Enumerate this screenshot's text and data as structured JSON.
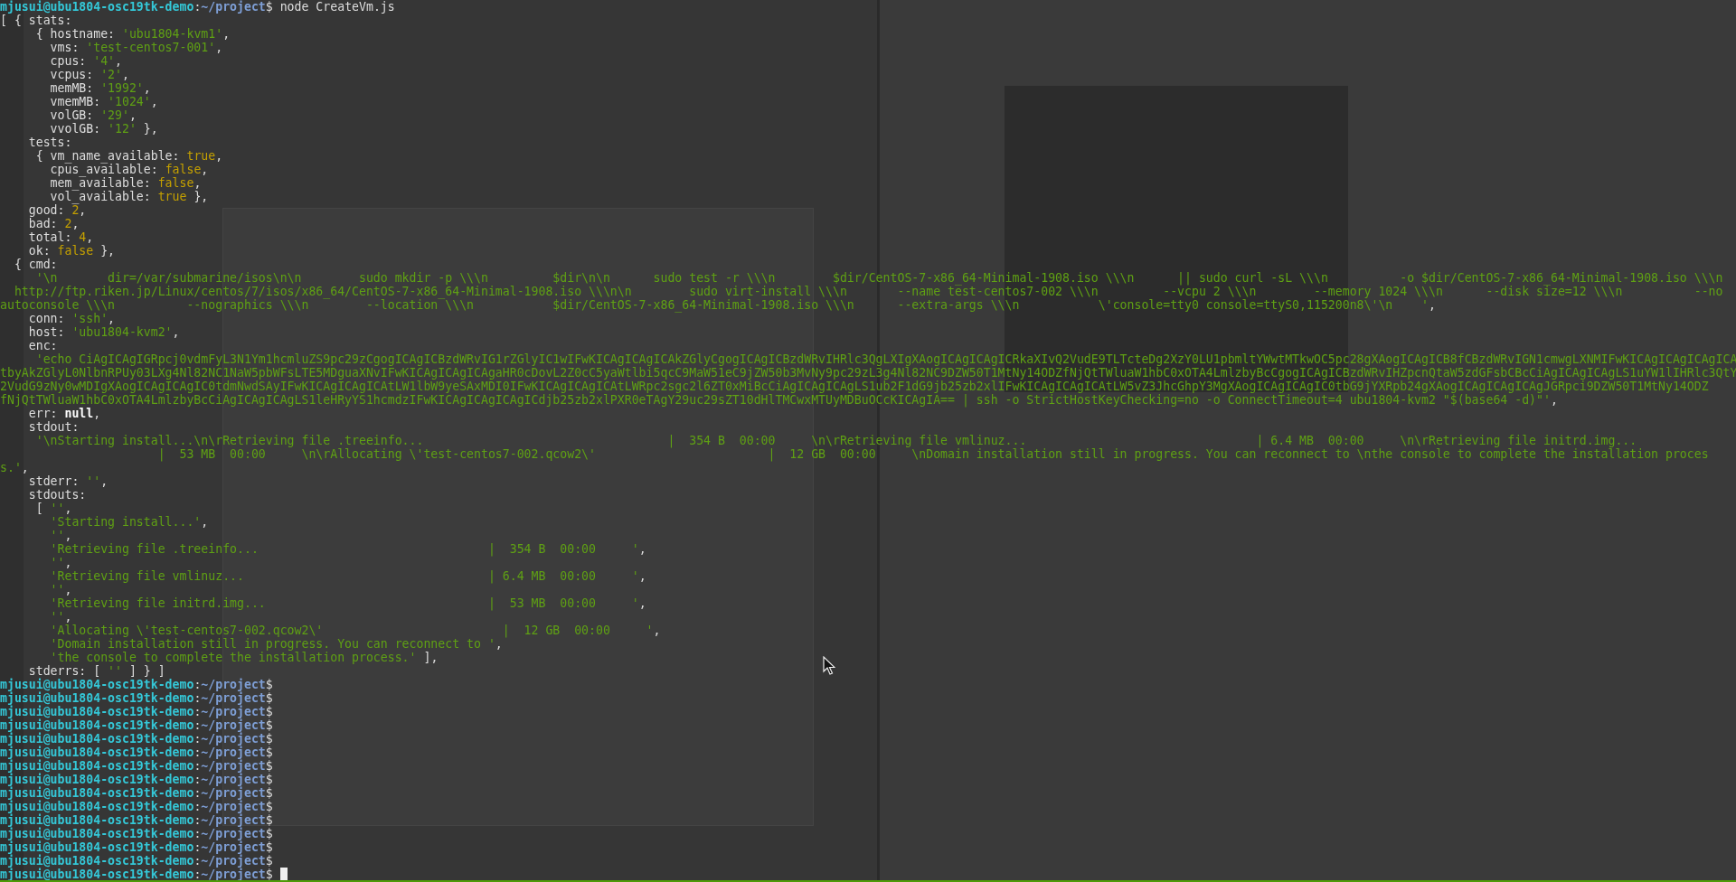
{
  "terminal": {
    "lines": [
      {
        "segments": [
          {
            "kind": "user",
            "text": "mjusui@ubu1804-osc19tk-demo"
          },
          {
            "kind": "plain",
            "text": ":"
          },
          {
            "kind": "path",
            "text": "~/project"
          },
          {
            "kind": "plain",
            "text": "$ node CreateVm.js"
          }
        ]
      },
      {
        "segments": [
          {
            "kind": "plain",
            "text": "[ { stats:"
          }
        ]
      },
      {
        "segments": [
          {
            "kind": "plain",
            "text": "     { hostname: "
          },
          {
            "kind": "string",
            "text": "'ubu1804-kvm1'"
          },
          {
            "kind": "plain",
            "text": ","
          }
        ]
      },
      {
        "segments": [
          {
            "kind": "plain",
            "text": "       vms: "
          },
          {
            "kind": "string",
            "text": "'test-centos7-001'"
          },
          {
            "kind": "plain",
            "text": ","
          }
        ]
      },
      {
        "segments": [
          {
            "kind": "plain",
            "text": "       cpus: "
          },
          {
            "kind": "string",
            "text": "'4'"
          },
          {
            "kind": "plain",
            "text": ","
          }
        ]
      },
      {
        "segments": [
          {
            "kind": "plain",
            "text": "       vcpus: "
          },
          {
            "kind": "string",
            "text": "'2'"
          },
          {
            "kind": "plain",
            "text": ","
          }
        ]
      },
      {
        "segments": [
          {
            "kind": "plain",
            "text": "       memMB: "
          },
          {
            "kind": "string",
            "text": "'1992'"
          },
          {
            "kind": "plain",
            "text": ","
          }
        ]
      },
      {
        "segments": [
          {
            "kind": "plain",
            "text": "       vmemMB: "
          },
          {
            "kind": "string",
            "text": "'1024'"
          },
          {
            "kind": "plain",
            "text": ","
          }
        ]
      },
      {
        "segments": [
          {
            "kind": "plain",
            "text": "       volGB: "
          },
          {
            "kind": "string",
            "text": "'29'"
          },
          {
            "kind": "plain",
            "text": ","
          }
        ]
      },
      {
        "segments": [
          {
            "kind": "plain",
            "text": "       vvolGB: "
          },
          {
            "kind": "string",
            "text": "'12'"
          },
          {
            "kind": "plain",
            "text": " },"
          }
        ]
      },
      {
        "segments": [
          {
            "kind": "plain",
            "text": "    tests:"
          }
        ]
      },
      {
        "segments": [
          {
            "kind": "plain",
            "text": "     { vm_name_available: "
          },
          {
            "kind": "literal",
            "text": "true"
          },
          {
            "kind": "plain",
            "text": ","
          }
        ]
      },
      {
        "segments": [
          {
            "kind": "plain",
            "text": "       cpus_available: "
          },
          {
            "kind": "literal",
            "text": "false"
          },
          {
            "kind": "plain",
            "text": ","
          }
        ]
      },
      {
        "segments": [
          {
            "kind": "plain",
            "text": "       mem_available: "
          },
          {
            "kind": "literal",
            "text": "false"
          },
          {
            "kind": "plain",
            "text": ","
          }
        ]
      },
      {
        "segments": [
          {
            "kind": "plain",
            "text": "       vol_available: "
          },
          {
            "kind": "literal",
            "text": "true"
          },
          {
            "kind": "plain",
            "text": " },"
          }
        ]
      },
      {
        "segments": [
          {
            "kind": "plain",
            "text": "    good: "
          },
          {
            "kind": "literal",
            "text": "2"
          },
          {
            "kind": "plain",
            "text": ","
          }
        ]
      },
      {
        "segments": [
          {
            "kind": "plain",
            "text": "    bad: "
          },
          {
            "kind": "literal",
            "text": "2"
          },
          {
            "kind": "plain",
            "text": ","
          }
        ]
      },
      {
        "segments": [
          {
            "kind": "plain",
            "text": "    total: "
          },
          {
            "kind": "literal",
            "text": "4"
          },
          {
            "kind": "plain",
            "text": ","
          }
        ]
      },
      {
        "segments": [
          {
            "kind": "plain",
            "text": "    ok: "
          },
          {
            "kind": "literal",
            "text": "false"
          },
          {
            "kind": "plain",
            "text": " },"
          }
        ]
      },
      {
        "segments": [
          {
            "kind": "plain",
            "text": "  { cmd:"
          }
        ]
      },
      {
        "segments": [
          {
            "kind": "string",
            "text": "     '\\n       dir=/var/submarine/isos\\n\\n        sudo mkdir -p \\\\\\n         $dir\\n\\n      sudo test -r \\\\\\n        $dir/CentOS-7-x86_64-Minimal-1908.iso \\\\\\n      || sudo curl -sL \\\\\\n          -o $dir/CentOS-7-x86_64-Minimal-1908.iso \\\\\\n"
          }
        ]
      },
      {
        "segments": [
          {
            "kind": "string",
            "text": "  http://ftp.riken.jp/Linux/centos/7/isos/x86_64/CentOS-7-x86_64-Minimal-1908.iso \\\\\\n\\n        sudo virt-install \\\\\\n       --name test-centos7-002 \\\\\\n         --vcpu 2 \\\\\\n        --memory 1024 \\\\\\n      --disk size=12 \\\\\\n          --no"
          }
        ]
      },
      {
        "segments": [
          {
            "kind": "string",
            "text": "autoconsole \\\\\\n          --nographics \\\\\\n        --location \\\\\\n           $dir/CentOS-7-x86_64-Minimal-1908.iso \\\\\\n      --extra-args \\\\\\n           \\'console=tty0 console=ttyS0,115200n8\\'\\n    '"
          },
          {
            "kind": "plain",
            "text": ","
          }
        ]
      },
      {
        "segments": [
          {
            "kind": "plain",
            "text": "    conn: "
          },
          {
            "kind": "string",
            "text": "'ssh'"
          },
          {
            "kind": "plain",
            "text": ","
          }
        ]
      },
      {
        "segments": [
          {
            "kind": "plain",
            "text": "    host: "
          },
          {
            "kind": "string",
            "text": "'ubu1804-kvm2'"
          },
          {
            "kind": "plain",
            "text": ","
          }
        ]
      },
      {
        "segments": [
          {
            "kind": "plain",
            "text": "    enc:"
          }
        ]
      },
      {
        "segments": [
          {
            "kind": "string",
            "text": "     'echo CiAgICAgIGRpcj0vdmFyL3N1Ym1hcmluZS9pc29zCgogICAgICBzdWRvIG1rZGlyIC1wIFwKICAgICAgICAkZGlyCgogICAgICBzdWRvIHRlc3QgLXIgXAogICAgICAgICRkaXIvQ2VudE9TLTcteDg2XzY0LU1pbmltYWwtMTkwOC5pc28gXAogICAgICB8fCBzdWRvIGN1cmwgLXNMIFwKICAgICAgICAgICA"
          }
        ]
      },
      {
        "segments": [
          {
            "kind": "string",
            "text": "tbyAkZGlyL0NlbnRPUy03LXg4Nl82NC1NaW5pbWFsLTE5MDguaXNvIFwKICAgICAgICAgaHR0cDovL2Z0cC5yaWtlbi5qcC9MaW51eC9jZW50b3MvNy9pc29zL3g4Nl82NC9DZW50T1MtNy14ODZfNjQtTWluaW1hbC0xOTA4LmlzbyBcCgogICAgICBzdWRvIHZpcnQtaW5zdGFsbCBcCiAgICAgICAgLS1uYW1lIHRlc3QtY"
          }
        ]
      },
      {
        "segments": [
          {
            "kind": "string",
            "text": "2VudG9zNy0wMDIgXAogICAgICAgIC0tdmNwdSAyIFwKICAgICAgICAtLW1lbW9yeSAxMDI0IFwKICAgICAgICAtLWRpc2sgc2l6ZT0xMiBcCiAgICAgICAgLS1ub2F1dG9jb25zb2xlIFwKICAgICAgICAtLW5vZ3JhcGhpY3MgXAogICAgICAgIC0tbG9jYXRpb24gXAogICAgICAgICAgJGRpci9DZW50T1MtNy14ODZ"
          }
        ]
      },
      {
        "segments": [
          {
            "kind": "string",
            "text": "fNjQtTWluaW1hbC0xOTA4LmlzbyBcCiAgICAgICAgLS1leHRyYS1hcmdzIFwKICAgICAgICAgICdjb25zb2xlPXR0eTAgY29uc29sZT10dHlTMCwxMTUyMDBuOCcKICAgIA== | ssh -o StrictHostKeyChecking=no -o ConnectTimeout=4 ubu1804-kvm2 \"$(base64 -d)\"'"
          },
          {
            "kind": "plain",
            "text": ","
          }
        ]
      },
      {
        "segments": [
          {
            "kind": "plain",
            "text": "    err: "
          },
          {
            "kind": "null",
            "text": "null"
          },
          {
            "kind": "plain",
            "text": ","
          }
        ]
      },
      {
        "segments": [
          {
            "kind": "plain",
            "text": "    stdout:"
          }
        ]
      },
      {
        "segments": [
          {
            "kind": "string",
            "text": "     '\\nStarting install...\\n\\rRetrieving file .treeinfo...                                  |  354 B  00:00     \\n\\rRetrieving file vmlinuz...                                | 6.4 MB  00:00     \\n\\rRetrieving file initrd.img..."
          }
        ]
      },
      {
        "segments": [
          {
            "kind": "string",
            "text": "                      |  53 MB  00:00     \\n\\rAllocating \\'test-centos7-002.qcow2\\'                        |  12 GB  00:00     \\nDomain installation still in progress. You can reconnect to \\nthe console to complete the installation proces"
          }
        ]
      },
      {
        "segments": [
          {
            "kind": "string",
            "text": "s.'"
          },
          {
            "kind": "plain",
            "text": ","
          }
        ]
      },
      {
        "segments": [
          {
            "kind": "plain",
            "text": "    stderr: "
          },
          {
            "kind": "string",
            "text": "''"
          },
          {
            "kind": "plain",
            "text": ","
          }
        ]
      },
      {
        "segments": [
          {
            "kind": "plain",
            "text": "    stdouts:"
          }
        ]
      },
      {
        "segments": [
          {
            "kind": "plain",
            "text": "     [ "
          },
          {
            "kind": "string",
            "text": "''"
          },
          {
            "kind": "plain",
            "text": ","
          }
        ]
      },
      {
        "segments": [
          {
            "kind": "string",
            "text": "       'Starting install...'"
          },
          {
            "kind": "plain",
            "text": ","
          }
        ]
      },
      {
        "segments": [
          {
            "kind": "string",
            "text": "       ''"
          },
          {
            "kind": "plain",
            "text": ","
          }
        ]
      },
      {
        "segments": [
          {
            "kind": "string",
            "text": "       'Retrieving file .treeinfo...                                |  354 B  00:00     '"
          },
          {
            "kind": "plain",
            "text": ","
          }
        ]
      },
      {
        "segments": [
          {
            "kind": "string",
            "text": "       ''"
          },
          {
            "kind": "plain",
            "text": ","
          }
        ]
      },
      {
        "segments": [
          {
            "kind": "string",
            "text": "       'Retrieving file vmlinuz...                                  | 6.4 MB  00:00     '"
          },
          {
            "kind": "plain",
            "text": ","
          }
        ]
      },
      {
        "segments": [
          {
            "kind": "string",
            "text": "       ''"
          },
          {
            "kind": "plain",
            "text": ","
          }
        ]
      },
      {
        "segments": [
          {
            "kind": "string",
            "text": "       'Retrieving file initrd.img...                               |  53 MB  00:00     '"
          },
          {
            "kind": "plain",
            "text": ","
          }
        ]
      },
      {
        "segments": [
          {
            "kind": "string",
            "text": "       ''"
          },
          {
            "kind": "plain",
            "text": ","
          }
        ]
      },
      {
        "segments": [
          {
            "kind": "string",
            "text": "       'Allocating \\'test-centos7-002.qcow2\\'                         |  12 GB  00:00     '"
          },
          {
            "kind": "plain",
            "text": ","
          }
        ]
      },
      {
        "segments": [
          {
            "kind": "string",
            "text": "       'Domain installation still in progress. You can reconnect to '"
          },
          {
            "kind": "plain",
            "text": ","
          }
        ]
      },
      {
        "segments": [
          {
            "kind": "string",
            "text": "       'the console to complete the installation process.'"
          },
          {
            "kind": "plain",
            "text": " ],"
          }
        ]
      },
      {
        "segments": [
          {
            "kind": "plain",
            "text": "    stderrs: [ "
          },
          {
            "kind": "string",
            "text": "''"
          },
          {
            "kind": "plain",
            "text": " ] } ]"
          }
        ]
      },
      {
        "segments": [
          {
            "kind": "user",
            "text": "mjusui@ubu1804-osc19tk-demo"
          },
          {
            "kind": "plain",
            "text": ":"
          },
          {
            "kind": "path",
            "text": "~/project"
          },
          {
            "kind": "plain",
            "text": "$"
          }
        ]
      },
      {
        "segments": [
          {
            "kind": "user",
            "text": "mjusui@ubu1804-osc19tk-demo"
          },
          {
            "kind": "plain",
            "text": ":"
          },
          {
            "kind": "path",
            "text": "~/project"
          },
          {
            "kind": "plain",
            "text": "$"
          }
        ]
      },
      {
        "segments": [
          {
            "kind": "user",
            "text": "mjusui@ubu1804-osc19tk-demo"
          },
          {
            "kind": "plain",
            "text": ":"
          },
          {
            "kind": "path",
            "text": "~/project"
          },
          {
            "kind": "plain",
            "text": "$"
          }
        ]
      },
      {
        "segments": [
          {
            "kind": "user",
            "text": "mjusui@ubu1804-osc19tk-demo"
          },
          {
            "kind": "plain",
            "text": ":"
          },
          {
            "kind": "path",
            "text": "~/project"
          },
          {
            "kind": "plain",
            "text": "$"
          }
        ]
      },
      {
        "segments": [
          {
            "kind": "user",
            "text": "mjusui@ubu1804-osc19tk-demo"
          },
          {
            "kind": "plain",
            "text": ":"
          },
          {
            "kind": "path",
            "text": "~/project"
          },
          {
            "kind": "plain",
            "text": "$"
          }
        ]
      },
      {
        "segments": [
          {
            "kind": "user",
            "text": "mjusui@ubu1804-osc19tk-demo"
          },
          {
            "kind": "plain",
            "text": ":"
          },
          {
            "kind": "path",
            "text": "~/project"
          },
          {
            "kind": "plain",
            "text": "$"
          }
        ]
      },
      {
        "segments": [
          {
            "kind": "user",
            "text": "mjusui@ubu1804-osc19tk-demo"
          },
          {
            "kind": "plain",
            "text": ":"
          },
          {
            "kind": "path",
            "text": "~/project"
          },
          {
            "kind": "plain",
            "text": "$"
          }
        ]
      },
      {
        "segments": [
          {
            "kind": "user",
            "text": "mjusui@ubu1804-osc19tk-demo"
          },
          {
            "kind": "plain",
            "text": ":"
          },
          {
            "kind": "path",
            "text": "~/project"
          },
          {
            "kind": "plain",
            "text": "$"
          }
        ]
      },
      {
        "segments": [
          {
            "kind": "user",
            "text": "mjusui@ubu1804-osc19tk-demo"
          },
          {
            "kind": "plain",
            "text": ":"
          },
          {
            "kind": "path",
            "text": "~/project"
          },
          {
            "kind": "plain",
            "text": "$"
          }
        ]
      },
      {
        "segments": [
          {
            "kind": "user",
            "text": "mjusui@ubu1804-osc19tk-demo"
          },
          {
            "kind": "plain",
            "text": ":"
          },
          {
            "kind": "path",
            "text": "~/project"
          },
          {
            "kind": "plain",
            "text": "$"
          }
        ]
      },
      {
        "segments": [
          {
            "kind": "user",
            "text": "mjusui@ubu1804-osc19tk-demo"
          },
          {
            "kind": "plain",
            "text": ":"
          },
          {
            "kind": "path",
            "text": "~/project"
          },
          {
            "kind": "plain",
            "text": "$"
          }
        ]
      },
      {
        "segments": [
          {
            "kind": "user",
            "text": "mjusui@ubu1804-osc19tk-demo"
          },
          {
            "kind": "plain",
            "text": ":"
          },
          {
            "kind": "path",
            "text": "~/project"
          },
          {
            "kind": "plain",
            "text": "$"
          }
        ]
      },
      {
        "segments": [
          {
            "kind": "user",
            "text": "mjusui@ubu1804-osc19tk-demo"
          },
          {
            "kind": "plain",
            "text": ":"
          },
          {
            "kind": "path",
            "text": "~/project"
          },
          {
            "kind": "plain",
            "text": "$"
          }
        ]
      },
      {
        "segments": [
          {
            "kind": "user",
            "text": "mjusui@ubu1804-osc19tk-demo"
          },
          {
            "kind": "plain",
            "text": ":"
          },
          {
            "kind": "path",
            "text": "~/project"
          },
          {
            "kind": "plain",
            "text": "$"
          }
        ]
      },
      {
        "cursor": true,
        "segments": [
          {
            "kind": "user",
            "text": "mjusui@ubu1804-osc19tk-demo"
          },
          {
            "kind": "plain",
            "text": ":"
          },
          {
            "kind": "path",
            "text": "~/project"
          },
          {
            "kind": "plain",
            "text": "$"
          }
        ]
      }
    ]
  }
}
